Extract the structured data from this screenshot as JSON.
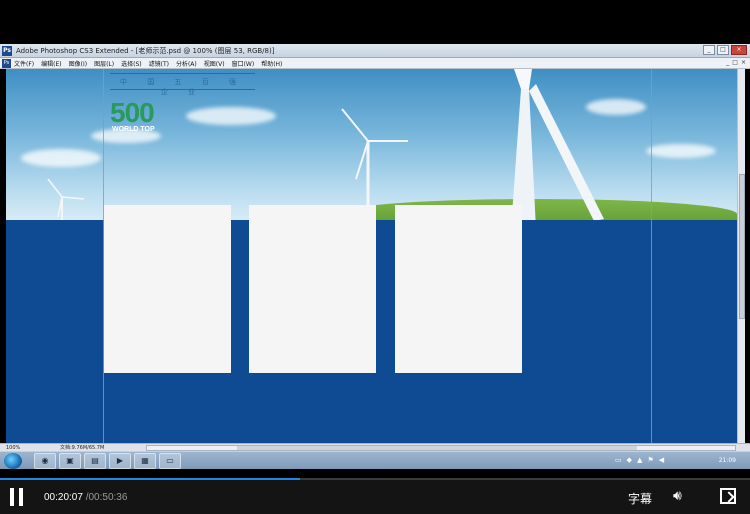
{
  "photoshop": {
    "window_title": "Adobe Photoshop CS3 Extended - [老师示范.psd @ 100% (图层 53, RGB/8)]",
    "badge": "Ps",
    "menu": [
      "文件(F)",
      "编辑(E)",
      "图像(I)",
      "图层(L)",
      "选择(S)",
      "滤镜(T)",
      "分析(A)",
      "视图(V)",
      "窗口(W)",
      "帮助(H)"
    ],
    "window_controls": [
      "_",
      "□",
      "×"
    ],
    "doc_controls": [
      "_",
      "□",
      "×"
    ]
  },
  "canvas": {
    "brand_cn": "中 国 五 百 强 企 业",
    "brand_number": "500",
    "brand_sub": "WORLD TOP",
    "colors": {
      "sky": "#7bb8dc",
      "blue": "#0e4b92",
      "card": "#f5f5f5",
      "number": "#2a9a5a"
    }
  },
  "status": {
    "zoom": "100%",
    "doc": "文档:9.76M/65.7M"
  },
  "taskbar": {
    "apps": [
      "firefox-icon",
      "photoshop-icon",
      "folder-icon",
      "media-icon",
      "calculator-icon",
      "document-icon"
    ],
    "clock": "21:09"
  },
  "player": {
    "current_time": "00:20:07",
    "duration": "/00:50:36",
    "subtitles_label": "字幕",
    "progress": 0.4
  }
}
